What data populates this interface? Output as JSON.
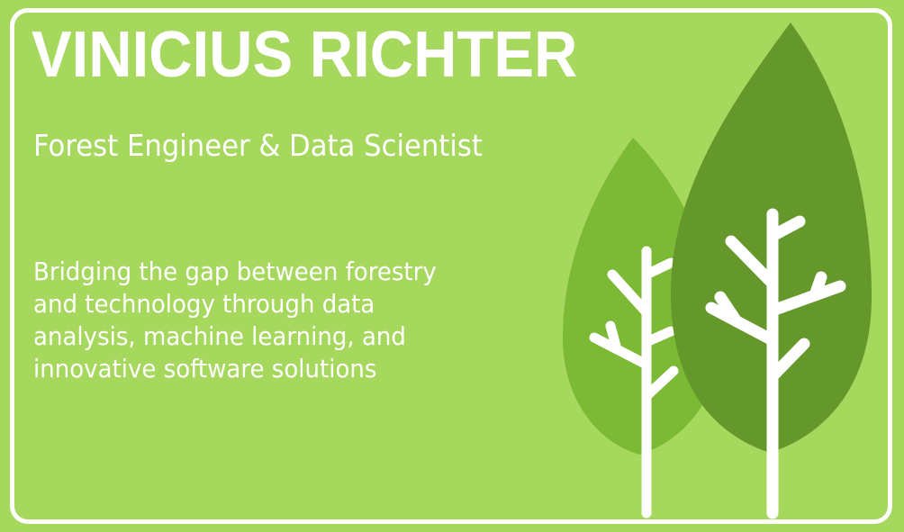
{
  "header": {
    "name": "VINICIUS RICHTER",
    "subtitle": "Forest Engineer & Data Scientist"
  },
  "tagline": {
    "lines": [
      "Bridging the gap between forestry",
      "and technology through data",
      "analysis, machine learning, and",
      "innovative software solutions"
    ]
  },
  "colors": {
    "background": "#a5d85c",
    "border": "#ffffff",
    "text": "#ffffff",
    "leaf_light": "#7cb935",
    "leaf_dark": "#64982b",
    "trunk": "#ffffff"
  },
  "icons": {
    "illustration": "tree-icon"
  }
}
